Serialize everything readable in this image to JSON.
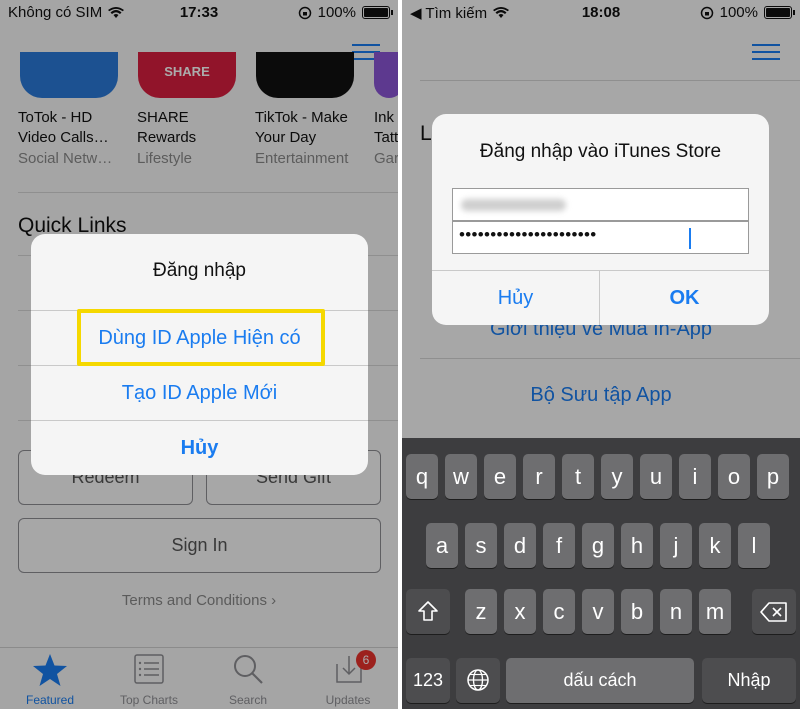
{
  "left": {
    "status": {
      "carrier": "Không có SIM",
      "time": "17:33",
      "battery": "100%"
    },
    "apps": [
      {
        "name_line1": "ToTok - HD",
        "name_line2": "Video Calls…",
        "category": "Social Netw…",
        "tile_text": ""
      },
      {
        "name_line1": "SHARE",
        "name_line2": "Rewards",
        "category": "Lifestyle",
        "tile_text": "SHARE"
      },
      {
        "name_line1": "TikTok - Make",
        "name_line2": "Your Day",
        "category": "Entertainment",
        "tile_text": ""
      },
      {
        "name_line1": "Ink",
        "name_line2": "Tatt",
        "category": "Gar",
        "tile_text": ""
      }
    ],
    "quick_links_title": "Quick Links",
    "redeem_label": "Redeem",
    "send_gift_label": "Send Gift",
    "sign_in_label": "Sign In",
    "terms_label": "Terms and Conditions ›",
    "tabs": [
      {
        "label": "Featured"
      },
      {
        "label": "Top Charts"
      },
      {
        "label": "Search"
      },
      {
        "label": "Updates",
        "badge": "6"
      }
    ],
    "dialog": {
      "title": "Đăng nhập",
      "existing_id": "Dùng ID Apple Hiện có",
      "new_id": "Tạo ID Apple Mới",
      "cancel": "Hủy"
    },
    "colors": {
      "accent": "#1a7cf0",
      "highlight": "#f5d800",
      "badge": "#e9322c"
    }
  },
  "right": {
    "status": {
      "back_label": "◀ Tìm kiếm",
      "time": "18:08",
      "battery": "100%"
    },
    "bg_letter": "L",
    "bg_link_1": "Giới thiệu về Mua In-App",
    "bg_link_2": "Bộ Sưu tập App",
    "dialog": {
      "title": "Đăng nhập vào iTunes Store",
      "password_mask": "••••••••••••••••••••••",
      "cancel": "Hủy",
      "ok": "OK"
    },
    "keyboard": {
      "row1": [
        "q",
        "w",
        "e",
        "r",
        "t",
        "y",
        "u",
        "i",
        "o",
        "p"
      ],
      "row2": [
        "a",
        "s",
        "d",
        "f",
        "g",
        "h",
        "j",
        "k",
        "l"
      ],
      "row3": [
        "z",
        "x",
        "c",
        "v",
        "b",
        "n",
        "m"
      ],
      "numbers": "123",
      "space": "dấu cách",
      "enter": "Nhập"
    }
  }
}
